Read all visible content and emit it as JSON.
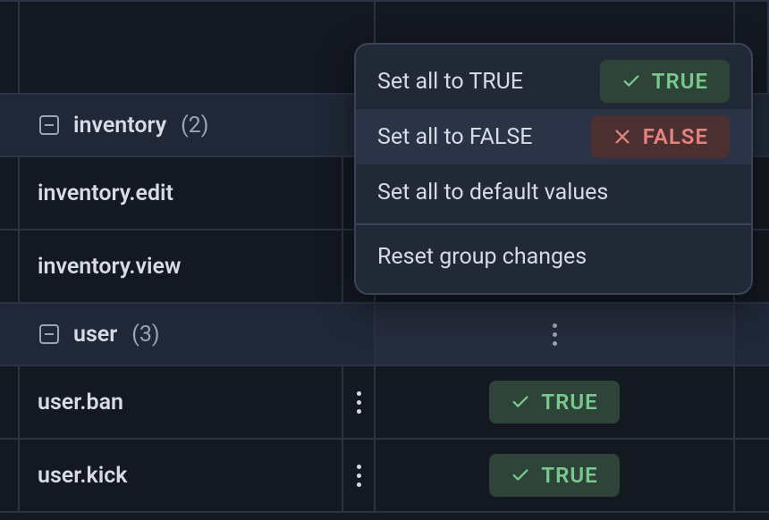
{
  "labels": {
    "true": "TRUE",
    "false": "FALSE"
  },
  "groups": [
    {
      "name": "inventory",
      "count": "(2)",
      "items": [
        {
          "key": "inventory.edit"
        },
        {
          "key": "inventory.view"
        }
      ]
    },
    {
      "name": "user",
      "count": "(3)",
      "items": [
        {
          "key": "user.ban",
          "value": "TRUE"
        },
        {
          "key": "user.kick",
          "value": "TRUE"
        }
      ]
    }
  ],
  "menu": {
    "set_true": "Set all to TRUE",
    "set_false": "Set all to FALSE",
    "set_default": "Set all to default values",
    "reset": "Reset group changes"
  }
}
